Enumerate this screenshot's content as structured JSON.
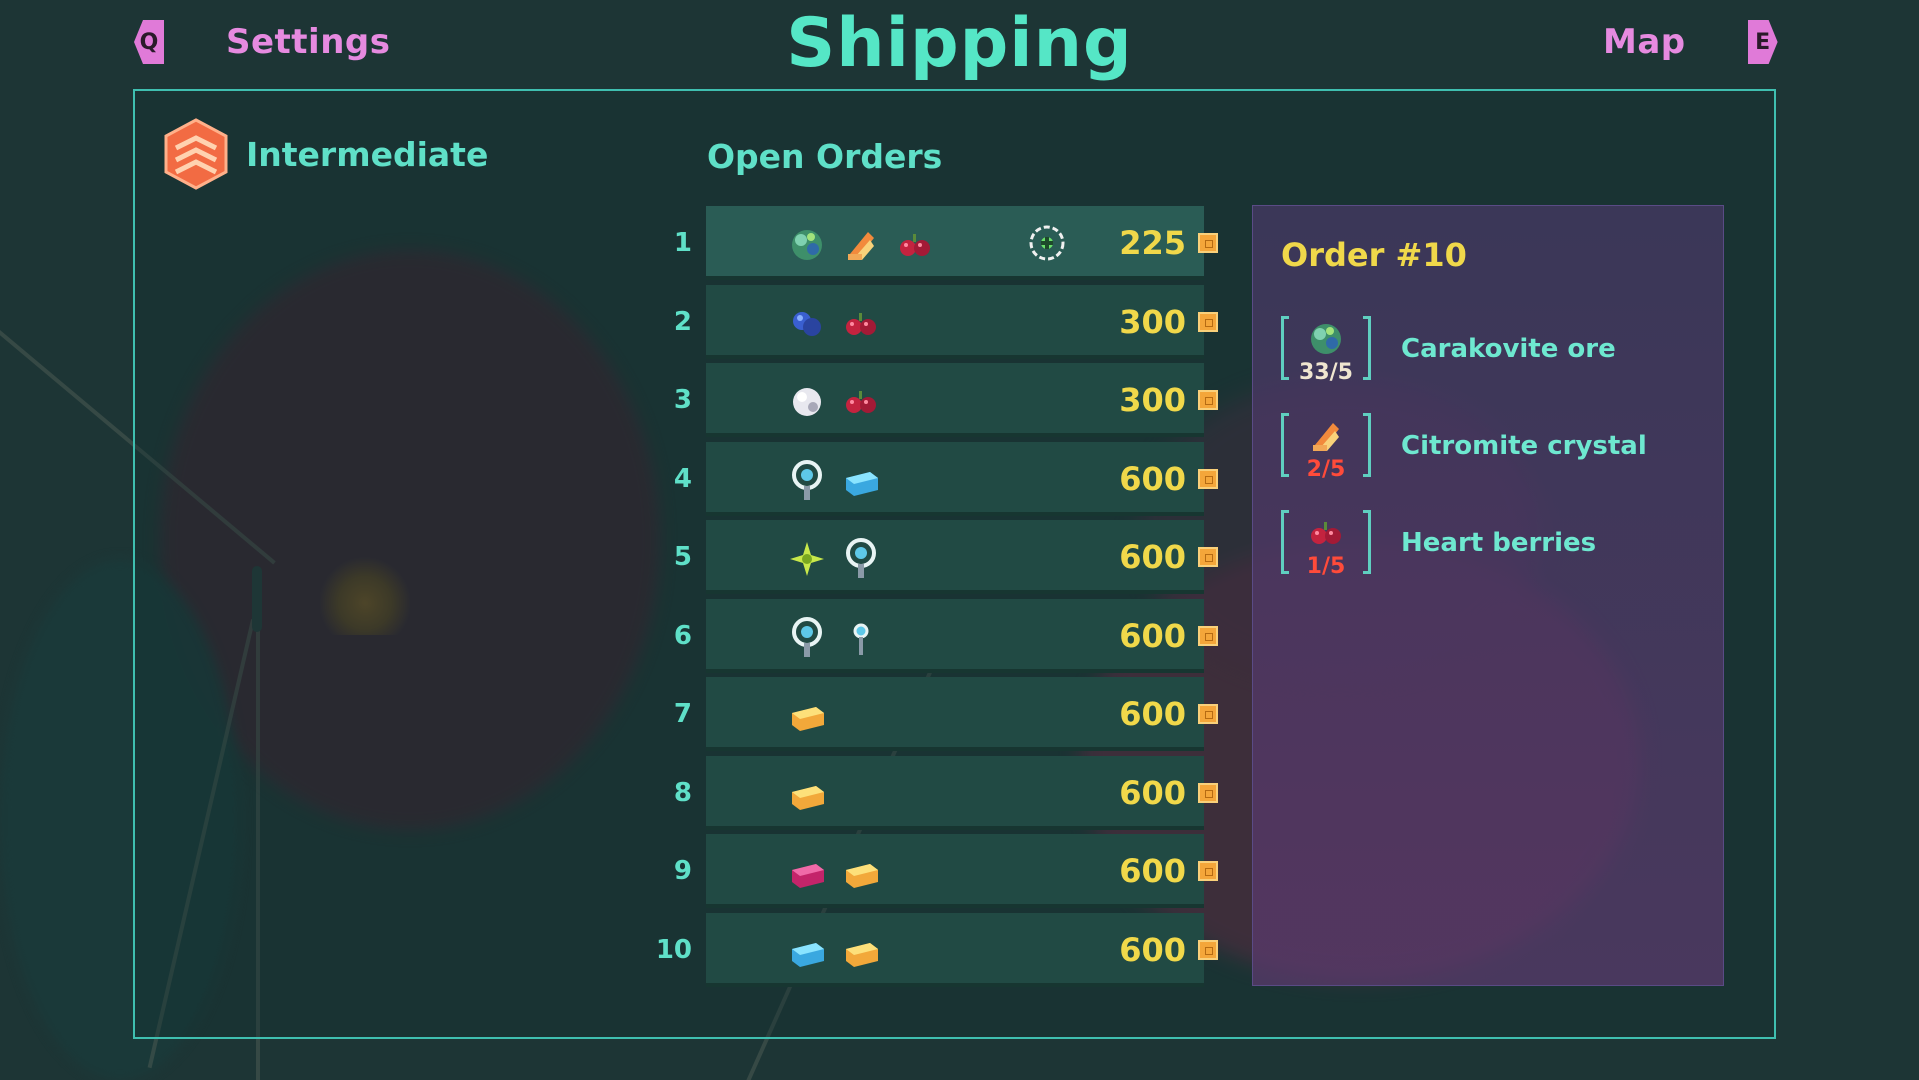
{
  "header": {
    "title": "Shipping",
    "left_key": "Q",
    "left_label": "Settings",
    "right_key": "E",
    "right_label": "Map"
  },
  "rank": {
    "label": "Intermediate",
    "icon": "rank-chevron-badge-icon",
    "color": "#f26b43"
  },
  "open_orders": {
    "title": "Open Orders",
    "rows": [
      {
        "num": "1",
        "items": [
          "carakovite-ore-icon",
          "citromite-crystal-icon",
          "heart-berries-icon"
        ],
        "reward": "225",
        "tracked": true
      },
      {
        "num": "2",
        "items": [
          "blue-ore-icon",
          "heart-berries-icon"
        ],
        "reward": "300"
      },
      {
        "num": "3",
        "items": [
          "white-ore-icon",
          "heart-berries-icon"
        ],
        "reward": "300"
      },
      {
        "num": "4",
        "items": [
          "lamp-icon",
          "cyan-bar-icon"
        ],
        "reward": "600"
      },
      {
        "num": "5",
        "items": [
          "star-flower-icon",
          "lamp-icon"
        ],
        "reward": "600"
      },
      {
        "num": "6",
        "items": [
          "lamp-icon",
          "small-lamp-icon"
        ],
        "reward": "600"
      },
      {
        "num": "7",
        "items": [
          "gold-bar-icon"
        ],
        "reward": "600"
      },
      {
        "num": "8",
        "items": [
          "gold-bar-icon"
        ],
        "reward": "600"
      },
      {
        "num": "9",
        "items": [
          "magenta-bar-icon",
          "gold-bar-icon"
        ],
        "reward": "600"
      },
      {
        "num": "10",
        "items": [
          "cyan-bar-icon",
          "gold-bar-icon"
        ],
        "reward": "600"
      }
    ]
  },
  "order_detail": {
    "title": "Order #10",
    "requirements": [
      {
        "name": "Carakovite ore",
        "count": "33/5",
        "icon": "carakovite-ore-icon",
        "met": true
      },
      {
        "name": "Citromite crystal",
        "count": "2/5",
        "icon": "citromite-crystal-icon",
        "met": false
      },
      {
        "name": "Heart berries",
        "count": "1/5",
        "icon": "heart-berries-icon",
        "met": false
      }
    ]
  },
  "colors": {
    "accent": "#55e6c6",
    "nav": "#e68ae0",
    "reward": "#f0d84a",
    "shortfall": "#ff4b3a"
  }
}
